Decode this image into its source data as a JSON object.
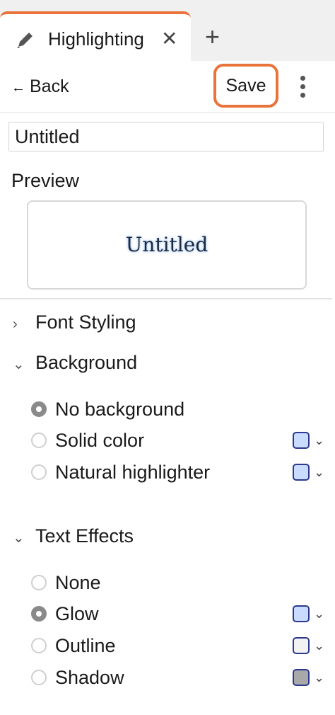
{
  "tab": {
    "title": "Highlighting",
    "close": "✕",
    "new": "+"
  },
  "toolbar": {
    "back": "Back",
    "save": "Save"
  },
  "name_input": {
    "value": "Untitled"
  },
  "preview": {
    "label": "Preview",
    "sample": "Untitled",
    "glow_color": "#9ec4ff"
  },
  "sections": {
    "font": {
      "label": "Font Styling",
      "expanded": false
    },
    "background": {
      "label": "Background",
      "expanded": true,
      "options": [
        {
          "label": "No background",
          "selected": true
        },
        {
          "label": "Solid color",
          "selected": false,
          "color": "#c9dbff"
        },
        {
          "label": "Natural highlighter",
          "selected": false,
          "color": "#c9dbff"
        }
      ]
    },
    "effects": {
      "label": "Text Effects",
      "expanded": true,
      "options": [
        {
          "label": "None",
          "selected": false
        },
        {
          "label": "Glow",
          "selected": true,
          "color": "#c9dbff"
        },
        {
          "label": "Outline",
          "selected": false,
          "color": "#f2f2f2"
        },
        {
          "label": "Shadow",
          "selected": false,
          "color": "#a8a8a8"
        }
      ]
    }
  },
  "colors": {
    "accent": "#e8743b",
    "swatch_border": "#2b3a8f"
  },
  "icons": {
    "tab": "pencil-icon",
    "menu": "kebab-icon"
  }
}
